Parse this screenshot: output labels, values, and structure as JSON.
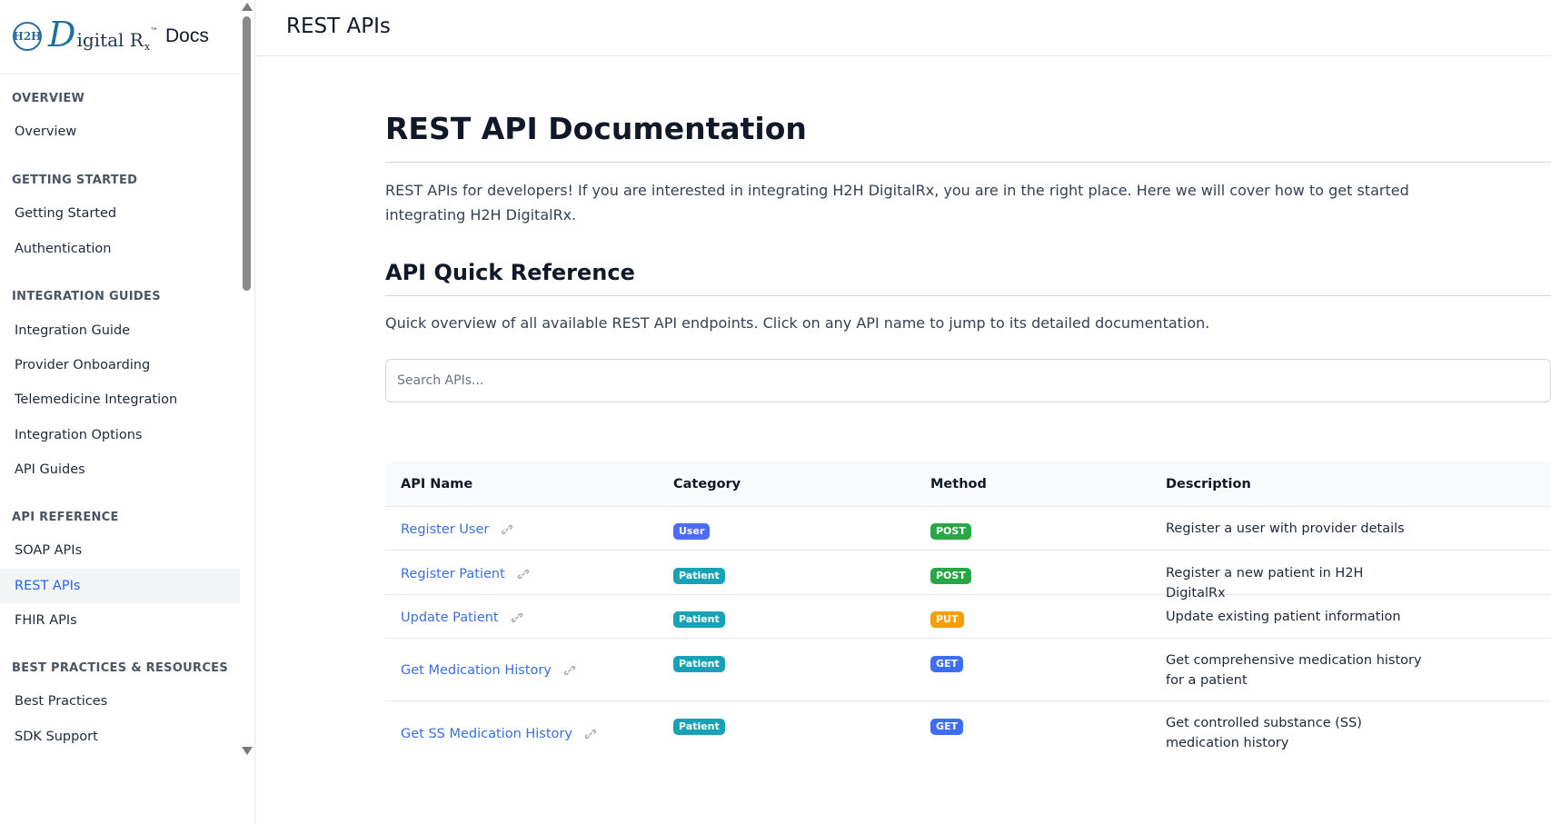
{
  "brand": {
    "mark": "H2H",
    "d_letter": "D",
    "name_rest": "igital R",
    "sub": "x",
    "tm": "™",
    "docs": "Docs"
  },
  "sidebar": {
    "sections": [
      {
        "title": "OVERVIEW",
        "items": [
          "Overview"
        ]
      },
      {
        "title": "GETTING STARTED",
        "items": [
          "Getting Started",
          "Authentication"
        ]
      },
      {
        "title": "INTEGRATION GUIDES",
        "items": [
          "Integration Guide",
          "Provider Onboarding",
          "Telemedicine Integration",
          "Integration Options",
          "API Guides"
        ]
      },
      {
        "title": "API REFERENCE",
        "items": [
          "SOAP APIs",
          "REST APIs",
          "FHIR APIs"
        ]
      },
      {
        "title": "BEST PRACTICES & RESOURCES",
        "items": [
          "Best Practices",
          "SDK Support"
        ]
      }
    ],
    "active": "REST APIs"
  },
  "header": {
    "title": "REST APIs"
  },
  "main": {
    "h1": "REST API Documentation",
    "intro": "REST APIs for developers! If you are interested in integrating H2H DigitalRx, you are in the right place. Here we will cover how to get started integrating H2H DigitalRx.",
    "h2": "API Quick Reference",
    "quick": "Quick overview of all available REST API endpoints. Click on any API name to jump to its detailed documentation.",
    "search_placeholder": "Search APIs..."
  },
  "table": {
    "headers": [
      "API Name",
      "Category",
      "Method",
      "Description"
    ],
    "rows": [
      {
        "name": "Register User",
        "category": "User",
        "method": "POST",
        "description": "Register a user with provider details"
      },
      {
        "name": "Register Patient",
        "category": "Patient",
        "method": "POST",
        "description": "Register a new patient in H2H DigitalRx"
      },
      {
        "name": "Update Patient",
        "category": "Patient",
        "method": "PUT",
        "description": "Update existing patient information"
      },
      {
        "name": "Get Medication History",
        "category": "Patient",
        "method": "GET",
        "description": "Get comprehensive medication history for a patient"
      },
      {
        "name": "Get SS Medication History",
        "category": "Patient",
        "method": "GET",
        "description": "Get controlled substance (SS) medication history"
      }
    ]
  },
  "colors": {
    "accent": "#2563eb",
    "link": "#3b6fd9",
    "badge_user": "#4a6cf7",
    "badge_patient": "#17a2b8",
    "method_post": "#28a745",
    "method_put": "#f5a000",
    "method_get": "#3d6ef5"
  },
  "icons": {
    "link": "link-icon",
    "scroll_up": "scroll-up-arrow-icon",
    "scroll_down": "scroll-down-arrow-icon"
  }
}
